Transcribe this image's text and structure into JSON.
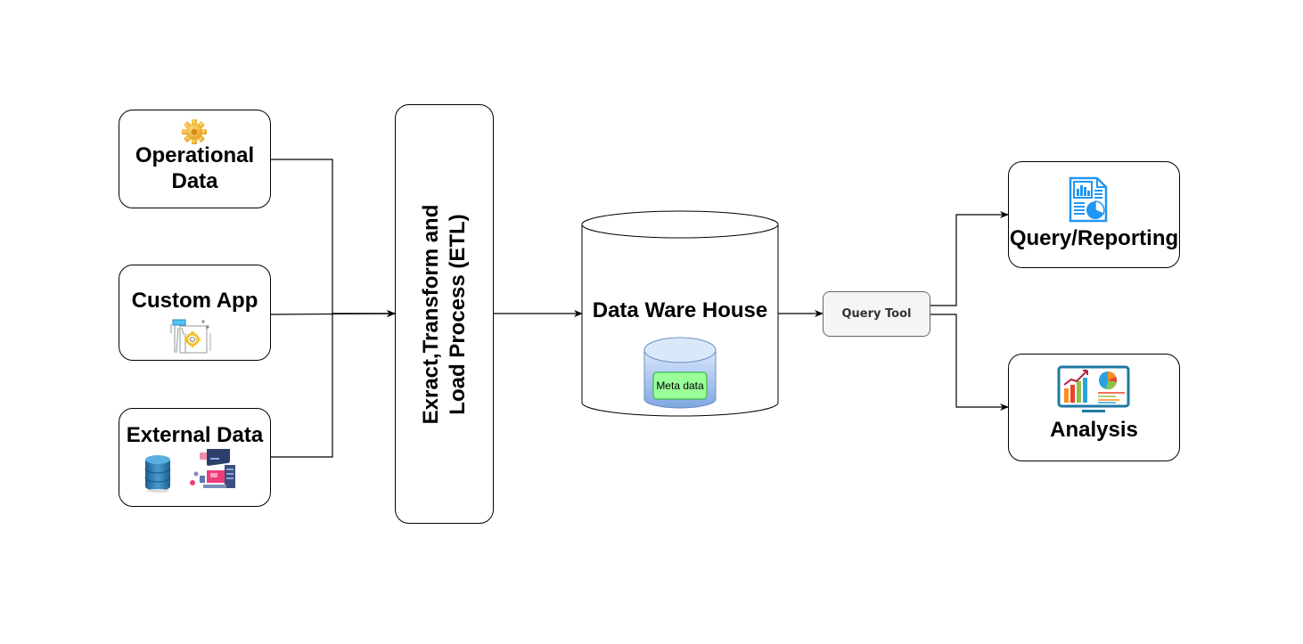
{
  "diagram": {
    "sources": [
      {
        "id": "operational",
        "label_line1": "Operational",
        "label_line2": "Data",
        "icon": "gear-icon"
      },
      {
        "id": "custom-app",
        "label": "Custom App",
        "icon": "app-settings-icon"
      },
      {
        "id": "external",
        "label": "External Data",
        "icons": [
          "database-icon",
          "server-workstation-icon"
        ]
      }
    ],
    "etl": {
      "label_line1": "Exract,Transform and",
      "label_line2": "Load Process (ETL)"
    },
    "warehouse": {
      "label": "Data Ware House",
      "metadata_label": "Meta data"
    },
    "query_tool": {
      "label": "Query Tool"
    },
    "outputs": [
      {
        "id": "query-reporting",
        "label": "Query/Reporting",
        "icon": "report-document-icon"
      },
      {
        "id": "analysis",
        "label": "Analysis",
        "icon": "analytics-monitor-icon"
      }
    ],
    "edges": [
      {
        "from": "operational",
        "to": "etl"
      },
      {
        "from": "custom-app",
        "to": "etl"
      },
      {
        "from": "external",
        "to": "etl"
      },
      {
        "from": "etl",
        "to": "warehouse"
      },
      {
        "from": "warehouse",
        "to": "query-tool"
      },
      {
        "from": "query-tool",
        "to": "query-reporting"
      },
      {
        "from": "query-tool",
        "to": "analysis"
      }
    ],
    "colors": {
      "query_tool_fill": "#f5f5f5",
      "metadata_fill": "#99ff99",
      "metadata_border": "#33aa33",
      "metadata_db_top": "#dae8fc",
      "metadata_db_bottom": "#7ea6e0",
      "report_icon": "#2196f3"
    }
  }
}
